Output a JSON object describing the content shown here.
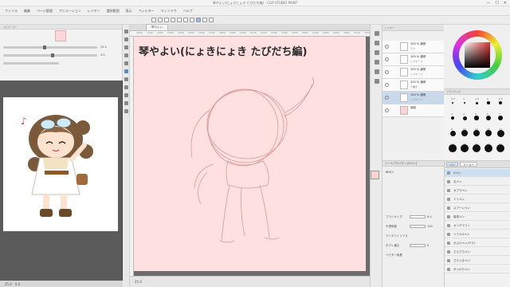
{
  "window": {
    "title": "琴やよい(にょきにょき たびだち編) - CLIP STUDIO PAINT",
    "controls": [
      "—",
      "☐",
      "✕"
    ]
  },
  "menubar": {
    "items": [
      "ファイル",
      "編集",
      "ページ管理",
      "アニメーション",
      "レイヤー",
      "選択範囲",
      "表示",
      "フィルター",
      "ウィンドウ",
      "ヘルプ"
    ]
  },
  "document": {
    "tab_label": "琴やよい",
    "ruler_ticks": [
      "1000",
      "1100",
      "1200",
      "1300",
      "1400",
      "1500",
      "1600",
      "1700",
      "1800",
      "1900",
      "2000",
      "2100",
      "2200",
      "2300",
      "2400",
      "2500",
      "2600",
      "2700",
      "2800",
      "2900",
      "3000",
      "3100",
      "3200"
    ],
    "canvas_title": "琴やよい(にょきにょき たびだち編)",
    "canvas_color": "#fde0df",
    "sketch_color": "#d99a9a",
    "zoom": "25.0"
  },
  "navigator": {
    "header": "ナビゲーター",
    "values": [
      "25.0",
      "0.0"
    ]
  },
  "reference": {
    "header": "サブビュー",
    "bottom_labels": [
      "25.0",
      "0.0"
    ]
  },
  "layers": {
    "header": "レイヤー",
    "items": [
      {
        "name": "100 % 通常",
        "mode": "ラフ",
        "selected": false
      },
      {
        "name": "100 % 通常",
        "mode": "レイヤー 2",
        "selected": false
      },
      {
        "name": "100 % 通常",
        "mode": "レイヤー 3",
        "selected": false
      },
      {
        "name": "100 % 通常",
        "mode": "下書き",
        "selected": false
      },
      {
        "name": "100 % 通常",
        "mode": "レイヤー 1",
        "selected": true
      },
      {
        "name": "用紙",
        "mode": "",
        "selected": false
      }
    ]
  },
  "brush_size": {
    "header": "ブラシサイズ",
    "sizes": [
      "0.7",
      "1",
      "1.5",
      "2",
      "2.5",
      "3",
      "4",
      "5",
      "6",
      "7",
      "8",
      "10",
      "12",
      "15",
      "17",
      "20",
      "25",
      "30",
      "40",
      "50"
    ]
  },
  "tool_property": {
    "header": "ツールプロパティ[Gペン]",
    "tool_name": "Gペン",
    "props": [
      {
        "label": "ブラシサイズ",
        "value": "8.0"
      },
      {
        "label": "不透明度",
        "value": "100"
      },
      {
        "label": "アンチエイリアス",
        "value": ""
      },
      {
        "label": "手ブレ補正",
        "value": "6"
      },
      {
        "label": "ベクター吸着",
        "value": ""
      }
    ]
  },
  "sub_tool": {
    "tabs": [
      "ペン",
      "マーカー"
    ],
    "items": [
      "Gペン",
      "丸ペン",
      "カブラペン",
      "ミリペン",
      "スプーンペン",
      "楷書ペン",
      "カリグラフィ",
      "リアルGペン",
      "かぶらペン(ザラ)",
      "さらさらペン",
      "ざらつきペン",
      "がっかりペン"
    ],
    "selected_index": 0
  },
  "colors": {
    "main_color": "#fcd2d2"
  }
}
